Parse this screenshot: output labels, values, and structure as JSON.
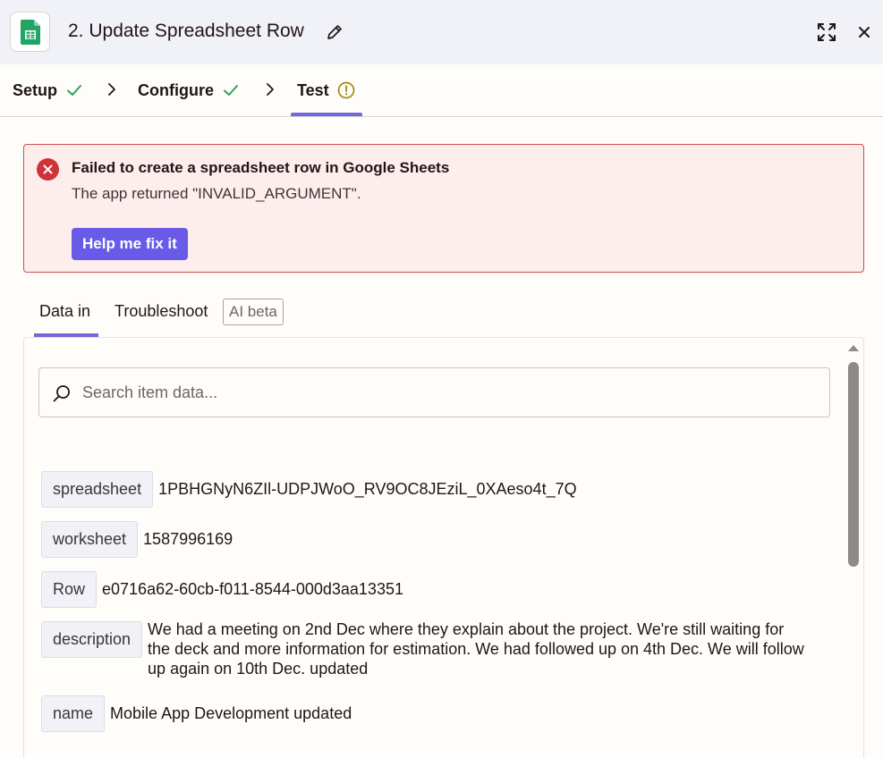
{
  "header": {
    "title": "2. Update Spreadsheet Row",
    "app_icon": "google-sheets-icon"
  },
  "steps": [
    {
      "label": "Setup",
      "status": "complete"
    },
    {
      "label": "Configure",
      "status": "complete"
    },
    {
      "label": "Test",
      "status": "warning"
    }
  ],
  "error": {
    "title": "Failed to create a spreadsheet row in Google Sheets",
    "message": "The app returned \"INVALID_ARGUMENT\".",
    "button_label": "Help me fix it"
  },
  "data_tabs": {
    "data_in": "Data in",
    "troubleshoot": "Troubleshoot",
    "badge": "AI beta"
  },
  "search": {
    "placeholder": "Search item data..."
  },
  "fields": [
    {
      "key": "spreadsheet",
      "value": "1PBHGNyN6ZIl-UDPJWoO_RV9OC8JEziL_0XAeso4t_7Q"
    },
    {
      "key": "worksheet",
      "value": "1587996169"
    },
    {
      "key": "Row",
      "value": "e0716a62-60cb-f011-8544-000d3aa13351"
    },
    {
      "key": "description",
      "value": "We had a meeting on 2nd Dec where they explain about the project. We're still waiting for the deck and more information for estimation. We had followed up on 4th Dec. We will follow up again on 10th Dec. updated"
    },
    {
      "key": "name",
      "value": "Mobile App Development updated"
    }
  ],
  "colors": {
    "accent": "#695be8",
    "success": "#2f9e5b",
    "warning": "#a88a14",
    "error": "#d0323a"
  }
}
